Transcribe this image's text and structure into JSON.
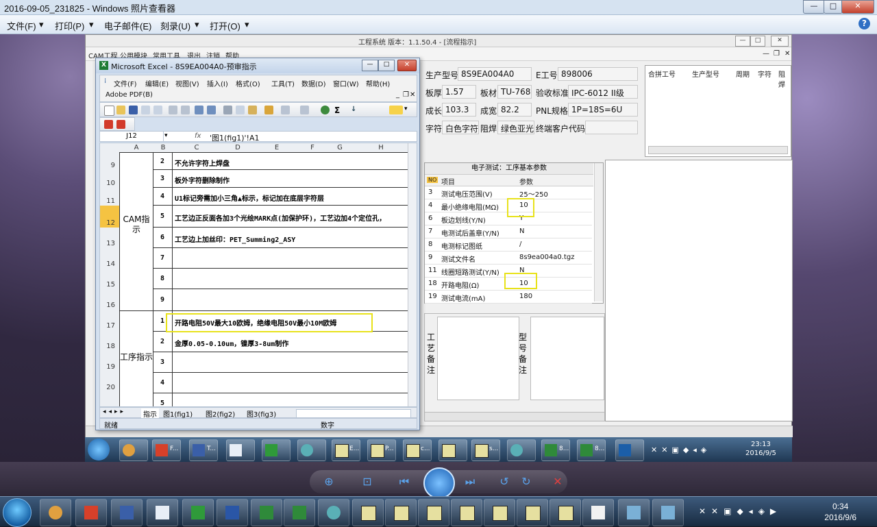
{
  "viewer": {
    "title": "2016-09-05_231825 - Windows 照片查看器",
    "menu": [
      {
        "label": "文件(F)"
      },
      {
        "label": "打印(P)"
      },
      {
        "label": "电子邮件(E)"
      },
      {
        "label": "刻录(U)"
      },
      {
        "label": "打开(O)"
      }
    ],
    "window_buttons": {
      "minimize": "—",
      "maximize": "□",
      "close": "✕"
    },
    "help": "?"
  },
  "cam": {
    "title": "工程系统  版本：1.1.50.4 - [流程指示]",
    "menu": [
      "CAM工程",
      "公用模块",
      "常用工具",
      "退出",
      "注销",
      "帮助"
    ],
    "info": {
      "prod_no_label": "生产型号",
      "prod_no": "8S9EA004A0",
      "e_no_label": "E工号",
      "e_no": "898006",
      "thickness_label": "板厚",
      "thickness": "1.57",
      "material_label": "板材",
      "material": "TU-768",
      "accept_label": "验收标准",
      "accept": "IPC-6012 II级",
      "length_label": "成长",
      "length": "103.3",
      "width_label": "成宽",
      "width": "82.2",
      "pnl_label": "PNL规格",
      "pnl": "1P=18S=6U",
      "char_label": "字符",
      "char": "白色字符",
      "mask_label": "阻焊",
      "mask": "绿色亚光",
      "customer_label": "终端客户代码",
      "customer": ""
    },
    "merge_table": {
      "headers": [
        "合拼工号",
        "生产型号",
        "周期",
        "字符",
        "阻焊"
      ]
    },
    "etest": {
      "title": "电子测试：工序基本参数",
      "headers": [
        "NO",
        "项目",
        "参数"
      ],
      "rows": [
        {
          "no": "3",
          "item": "测试电压范围(V)",
          "value": "25～250"
        },
        {
          "no": "4",
          "item": "最小绝缘电阻(MΩ)",
          "value": "10"
        },
        {
          "no": "6",
          "item": "板边划线(Y/N)",
          "value": "Y"
        },
        {
          "no": "7",
          "item": "电测试后盖章(Y/N)",
          "value": "N"
        },
        {
          "no": "8",
          "item": "电测标记图纸",
          "value": "/"
        },
        {
          "no": "9",
          "item": "测试文件名",
          "value": "8s9ea004a0.tgz"
        },
        {
          "no": "11",
          "item": "线圈短路测试(Y/N)",
          "value": "N"
        },
        {
          "no": "18",
          "item": "开路电阻(Ω)",
          "value": "10"
        },
        {
          "no": "19",
          "item": "测试电流(mA)",
          "value": "180"
        }
      ]
    },
    "notes": {
      "process_label": "工艺备注",
      "model_label": "型号备注"
    }
  },
  "excel": {
    "title": "Microsoft Excel - 8S9EA004A0-预审指示",
    "menu": [
      "文件(F)",
      "编辑(E)",
      "视图(V)",
      "插入(I)",
      "格式(O)",
      "工具(T)",
      "数据(D)",
      "窗口(W)",
      "帮助(H)"
    ],
    "addin": "Adobe PDF(B)",
    "name_box": "J12",
    "fx": "fx",
    "formula": "'图1(fig1)'!A1",
    "columns": [
      "A",
      "B",
      "C",
      "D",
      "E",
      "F",
      "G",
      "H"
    ],
    "rows": [
      {
        "row": "9",
        "num": "2",
        "text": "不允许字符上焊盘"
      },
      {
        "row": "10",
        "num": "3",
        "text": "板外字符删除制作"
      },
      {
        "row": "11",
        "num": "4",
        "text": "U1标记旁需加小三角▲标示，标记加在底层字符层"
      },
      {
        "row": "12",
        "num": "5",
        "text": "工艺边正反面各加3个光绘MARK点(加保护环)，工艺边加4个定位孔，"
      },
      {
        "row": "13",
        "num": "6",
        "text": "工艺边上加丝印：PET_Summing2_ASY"
      },
      {
        "row": "14",
        "num": "7",
        "text": ""
      },
      {
        "row": "15",
        "num": "8",
        "text": ""
      },
      {
        "row": "16",
        "num": "9",
        "text": ""
      },
      {
        "row": "17",
        "num": "1",
        "text": "开路电阻50V最大10欧姆，绝缘电阻50V最小10M欧姆"
      },
      {
        "row": "18",
        "num": "2",
        "text": "金厚0.05-0.10um，镍厚3-8um制作"
      },
      {
        "row": "19",
        "num": "3",
        "text": ""
      },
      {
        "row": "20",
        "num": "4",
        "text": ""
      },
      {
        "row": "",
        "num": "5",
        "text": ""
      }
    ],
    "group_cam": "CAM指示",
    "group_process": "工序指示",
    "tabs": [
      "指示",
      "图1(fig1)",
      "图2(fig2)",
      "图3(fig3)"
    ],
    "status_ready": "就绪",
    "status_num": "数字"
  },
  "inner_taskbar": {
    "items": [
      "F...",
      "T...",
      "",
      "",
      "",
      "E...",
      "P...",
      "c...",
      "",
      "s...",
      "",
      "8...",
      "8..."
    ],
    "time": "23:13",
    "date": "2016/9/5"
  },
  "taskbar": {
    "time": "0:34",
    "date": "2016/9/6"
  },
  "colors": {
    "highlight": "#e8e21a",
    "excel_green": "#1e7b34"
  }
}
